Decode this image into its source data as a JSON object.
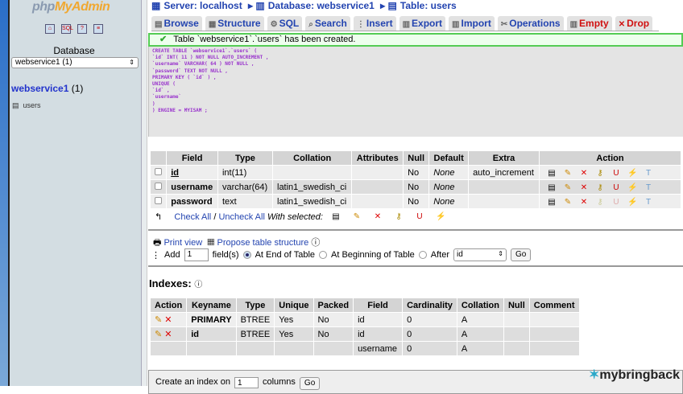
{
  "sidebar": {
    "logo": "phpMyAdmin",
    "db_label": "Database",
    "db_select": "webservice1 (1)",
    "db_link": "webservice1",
    "db_count": "(1)",
    "tables": [
      "users"
    ]
  },
  "breadcrumb": {
    "server": "Server: localhost",
    "database": "Database: webservice1",
    "table": "Table: users"
  },
  "tabs": [
    "Browse",
    "Structure",
    "SQL",
    "Search",
    "Insert",
    "Export",
    "Import",
    "Operations",
    "Empty",
    "Drop"
  ],
  "message": "Table `webservice1`.`users` has been created.",
  "sql_query": "CREATE TABLE `webservice1`.`users` (\n`id` INT( 11 ) NOT NULL AUTO_INCREMENT ,\n`username` VARCHAR( 64 ) NOT NULL ,\n`password` TEXT NOT NULL ,\nPRIMARY KEY ( `id` ) ,\nUNIQUE (\n`id` ,\n`username`\n)\n) ENGINE = MYISAM ;",
  "structure": {
    "headers": [
      "Field",
      "Type",
      "Collation",
      "Attributes",
      "Null",
      "Default",
      "Extra",
      "Action"
    ],
    "rows": [
      {
        "field": "id",
        "type": "int(11)",
        "collation": "",
        "attributes": "",
        "null": "No",
        "default": "None",
        "extra": "auto_increment"
      },
      {
        "field": "username",
        "type": "varchar(64)",
        "collation": "latin1_swedish_ci",
        "attributes": "",
        "null": "No",
        "default": "None",
        "extra": ""
      },
      {
        "field": "password",
        "type": "text",
        "collation": "latin1_swedish_ci",
        "attributes": "",
        "null": "No",
        "default": "None",
        "extra": ""
      }
    ]
  },
  "with_selected": {
    "check_all": "Check All",
    "sep": "/",
    "uncheck_all": "Uncheck All",
    "label": "With selected:"
  },
  "links": {
    "print_view": "Print view",
    "propose": "Propose table structure"
  },
  "add_field": {
    "label": "Add",
    "value": "1",
    "fields_label": "field(s)",
    "at_end": "At End of Table",
    "at_begin": "At Beginning of Table",
    "after": "After",
    "after_value": "id",
    "go": "Go"
  },
  "indexes": {
    "title": "Indexes:",
    "headers": [
      "Action",
      "Keyname",
      "Type",
      "Unique",
      "Packed",
      "Field",
      "Cardinality",
      "Collation",
      "Null",
      "Comment"
    ],
    "rows": [
      {
        "keyname": "PRIMARY",
        "type": "BTREE",
        "unique": "Yes",
        "packed": "No",
        "field": "id",
        "cardinality": "0",
        "collation": "A"
      },
      {
        "keyname": "id",
        "type": "BTREE",
        "unique": "Yes",
        "packed": "No",
        "field": "id",
        "cardinality": "0",
        "collation": "A"
      },
      {
        "keyname": "",
        "type": "",
        "unique": "",
        "packed": "",
        "field": "username",
        "cardinality": "0",
        "collation": "A"
      }
    ]
  },
  "create_index": {
    "label": "Create an index on",
    "value": "1",
    "columns": "columns",
    "go": "Go"
  },
  "watermark": "mybringback"
}
